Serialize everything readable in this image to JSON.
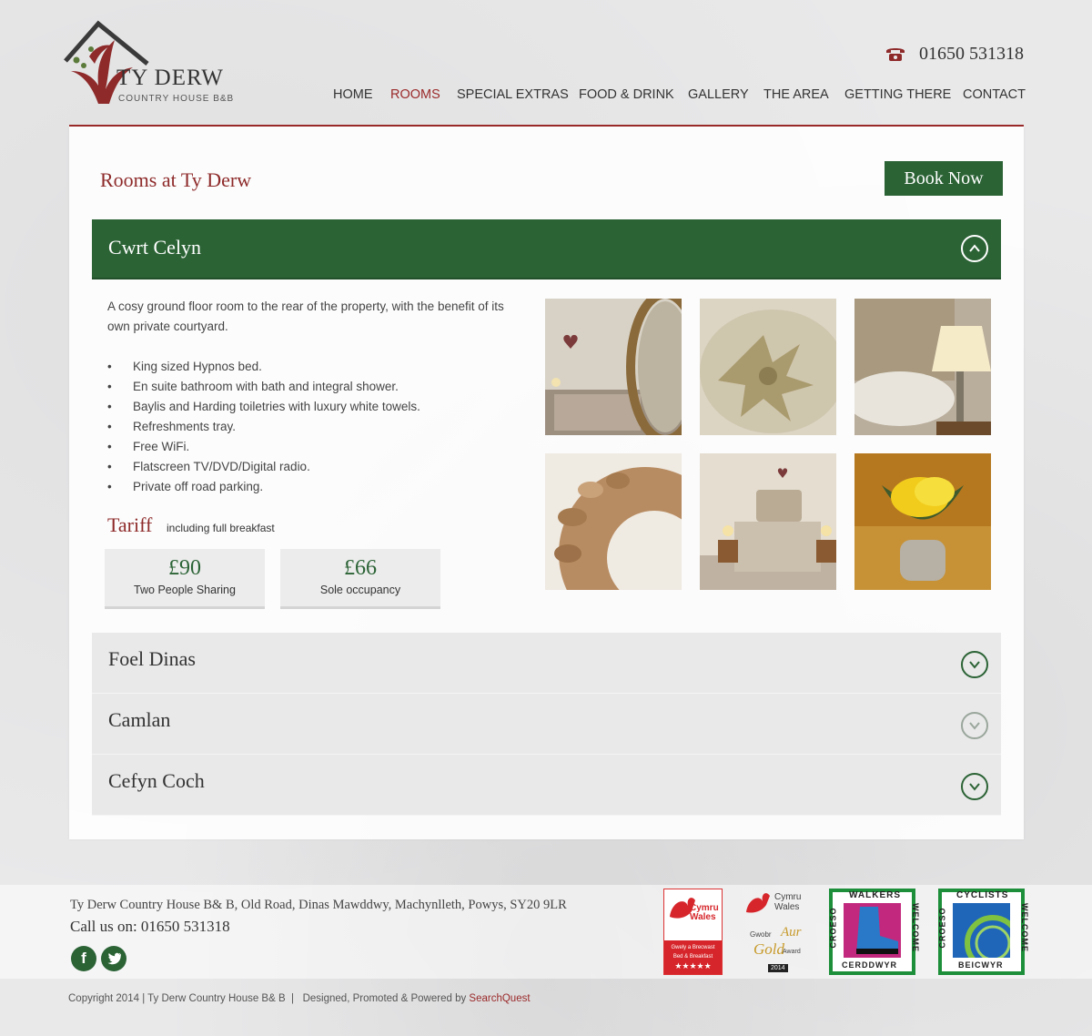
{
  "header": {
    "logo_title": "TY DERW",
    "logo_subtitle": "COUNTRY HOUSE B&B",
    "phone": "01650 531318",
    "nav": [
      {
        "label": "HOME"
      },
      {
        "label": "ROOMS",
        "active": true
      },
      {
        "label": "SPECIAL EXTRAS"
      },
      {
        "label": "FOOD & DRINK"
      },
      {
        "label": "GALLERY"
      },
      {
        "label": "THE AREA"
      },
      {
        "label": "GETTING THERE"
      },
      {
        "label": "CONTACT"
      }
    ]
  },
  "main": {
    "title": "Rooms at Ty Derw",
    "book_label": "Book Now",
    "open_room": {
      "name": "Cwrt Celyn",
      "description": "A cosy ground floor room to the rear of the property, with the benefit of its own private courtyard.",
      "features": [
        "King sized Hypnos bed.",
        "En suite bathroom with bath and integral shower.",
        "Baylis and Harding toiletries with luxury white towels.",
        "Refreshments tray.",
        "Free WiFi.",
        "Flatscreen TV/DVD/Digital radio.",
        "Private off road parking."
      ],
      "tariff_title": "Tariff",
      "tariff_note": "including full breakfast",
      "prices": [
        {
          "amount": "£90",
          "label": "Two People Sharing"
        },
        {
          "amount": "£66",
          "label": "Sole occupancy"
        }
      ],
      "photos": [
        "bedroom-mirror-photo",
        "embroidered-cushion-photo",
        "bedside-lamp-photo",
        "wooden-wreath-photo",
        "bedroom-wide-photo",
        "yellow-flower-photo"
      ]
    },
    "collapsed_rooms": [
      {
        "name": "Foel Dinas"
      },
      {
        "name": "Camlan"
      },
      {
        "name": "Cefyn Coch"
      }
    ]
  },
  "footer": {
    "address": "Ty Derw Country House B& B, Old Road, Dinas Mawddwy, Machynlleth, Powys, SY20 9LR",
    "call": "Call us on: 01650 531318",
    "badges": {
      "cymru_wales": "Cymru Wales",
      "gwely": "Gwely a Brecwast",
      "bnb": "Bed & Breakfast",
      "stars": "★★★★★",
      "gwobr": "Gwobr",
      "aur": "Aur",
      "gold": "Gold",
      "award": "Award",
      "year": "2014",
      "croeso": "CROESO",
      "walkers": "WALKERS",
      "welcome": "WELCOME",
      "cerddwyr": "CERDDWYR",
      "cyclists": "CYCLISTS",
      "beicwyr": "BEICWYR"
    },
    "copyright": "Copyright 2014 | Ty Derw Country House B& B  |   Designed, Promoted & Powered by ",
    "powered_by": "SearchQuest"
  },
  "colors": {
    "brand_red": "#9b2a2a",
    "brand_green": "#2b6335"
  }
}
